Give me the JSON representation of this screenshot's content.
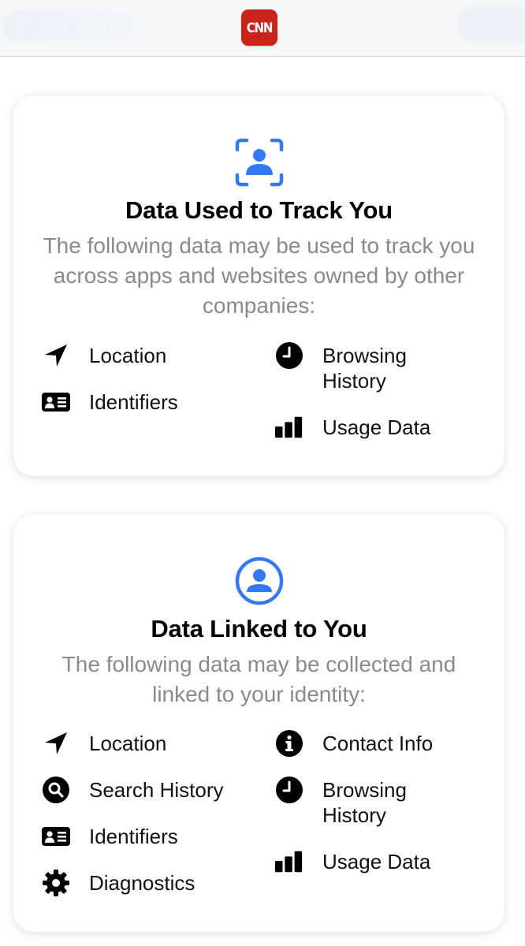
{
  "app": {
    "logo_text": "CNN",
    "logo_color": "#c8241c"
  },
  "accent_color": "#3478f6",
  "sections": [
    {
      "icon": "track-user-icon",
      "title": "Data Used to Track You",
      "description": "The following data may be used to track you across apps and websites owned by other companies:",
      "items": [
        {
          "icon": "location-arrow-icon",
          "label": "Location"
        },
        {
          "icon": "id-card-icon",
          "label": "Identifiers"
        },
        {
          "icon": "clock-icon",
          "label": "Browsing History"
        },
        {
          "icon": "bar-chart-icon",
          "label": "Usage Data"
        }
      ]
    },
    {
      "icon": "user-circle-icon",
      "title": "Data Linked to You",
      "description": "The following data may be collected and linked to your identity:",
      "items": [
        {
          "icon": "location-arrow-icon",
          "label": "Location"
        },
        {
          "icon": "search-icon",
          "label": "Search History"
        },
        {
          "icon": "id-card-icon",
          "label": "Identifiers"
        },
        {
          "icon": "gear-icon",
          "label": "Diagnostics"
        },
        {
          "icon": "info-icon",
          "label": "Contact Info"
        },
        {
          "icon": "clock-icon",
          "label": "Browsing History"
        },
        {
          "icon": "bar-chart-icon",
          "label": "Usage Data"
        }
      ]
    }
  ]
}
